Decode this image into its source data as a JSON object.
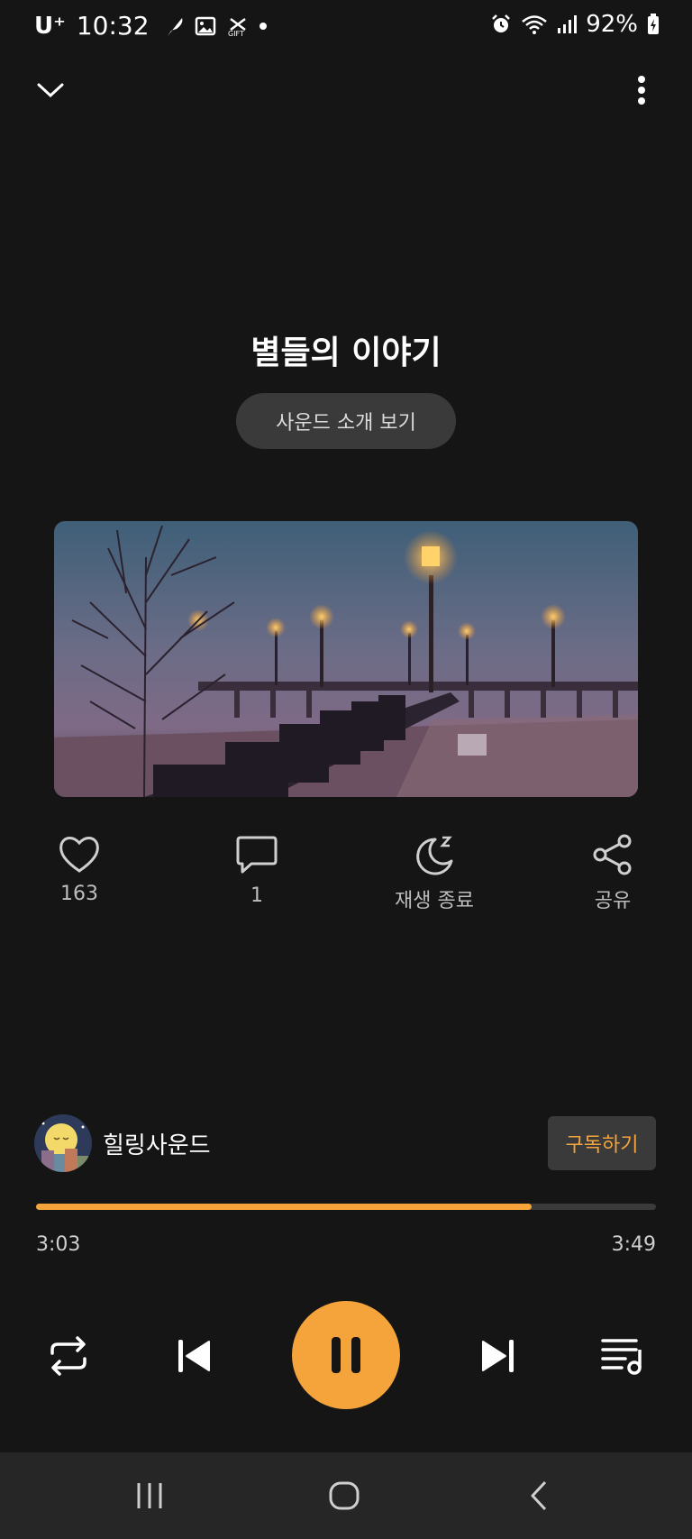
{
  "status_bar": {
    "carrier": "U⁺",
    "time": "10:32",
    "battery": "92%",
    "icons_left": [
      "feather-icon",
      "image-icon",
      "gift-icon",
      "dot-icon"
    ],
    "icons_right": [
      "alarm-icon",
      "wifi-icon",
      "signal-icon",
      "battery-icon"
    ]
  },
  "header": {
    "collapse_icon": "chevron-down-icon",
    "menu_icon": "more-vertical-icon"
  },
  "track": {
    "title": "별들의 이야기",
    "intro_button": "사운드 소개 보기"
  },
  "actions": [
    {
      "icon": "heart-icon",
      "label": "163"
    },
    {
      "icon": "comment-icon",
      "label": "1"
    },
    {
      "icon": "sleep-timer-icon",
      "label": "재생 종료"
    },
    {
      "icon": "share-icon",
      "label": "공유"
    }
  ],
  "channel": {
    "name": "힐링사운드",
    "subscribe_label": "구독하기"
  },
  "progress": {
    "current": "3:03",
    "total": "3:49",
    "fraction": 0.8
  },
  "controls": {
    "repeat_icon": "repeat-icon",
    "prev_icon": "skip-previous-icon",
    "play_pause_icon": "pause-icon",
    "next_icon": "skip-next-icon",
    "playlist_icon": "playlist-icon"
  },
  "navbar": {
    "recents_icon": "recents-icon",
    "home_icon": "home-icon",
    "back_icon": "back-icon"
  },
  "colors": {
    "accent": "#f4a43a",
    "background": "#151515",
    "button_bg": "#3a3a3a"
  }
}
